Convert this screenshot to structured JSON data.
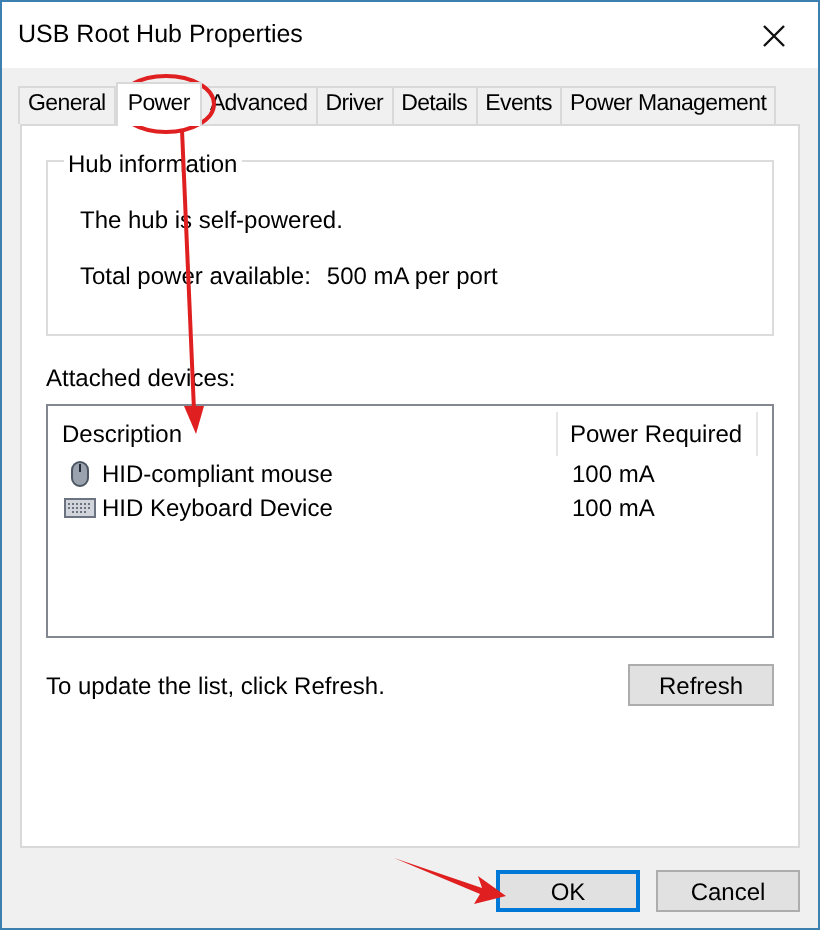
{
  "window": {
    "title": "USB Root Hub Properties"
  },
  "tabs": [
    {
      "label": "General",
      "selected": false
    },
    {
      "label": "Power",
      "selected": true
    },
    {
      "label": "Advanced",
      "selected": false
    },
    {
      "label": "Driver",
      "selected": false
    },
    {
      "label": "Details",
      "selected": false
    },
    {
      "label": "Events",
      "selected": false
    },
    {
      "label": "Power Management",
      "selected": false
    }
  ],
  "hub_information": {
    "title": "Hub information",
    "status": "The hub is self-powered.",
    "total_power_label": "Total power available:",
    "total_power_value": "500 mA per port"
  },
  "attached_devices": {
    "label": "Attached devices:",
    "columns": [
      "Description",
      "Power Required"
    ],
    "rows": [
      {
        "kind": "mouse",
        "description": "HID-compliant mouse",
        "power": "100 mA"
      },
      {
        "kind": "keyboard",
        "description": "HID Keyboard Device",
        "power": "100 mA"
      }
    ]
  },
  "hint": "To update the list, click Refresh.",
  "refresh_button": "Refresh",
  "buttons": [
    {
      "label": "OK",
      "default": true
    },
    {
      "label": "Cancel",
      "default": false
    }
  ]
}
